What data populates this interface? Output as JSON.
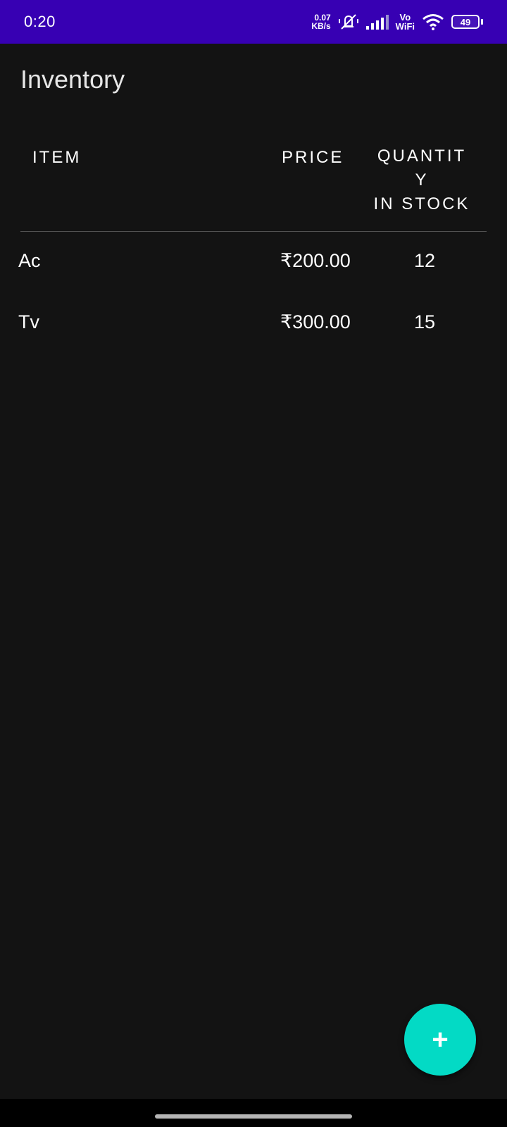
{
  "status_bar": {
    "time": "0:20",
    "net_speed_value": "0.07",
    "net_speed_unit": "KB/s",
    "vowifi_top": "Vo",
    "vowifi_bottom": "WiFi",
    "battery": "49",
    "color": "#3700b3"
  },
  "app": {
    "title": "Inventory"
  },
  "table": {
    "headers": {
      "item": "ITEM",
      "price": "PRICE",
      "quantity_line1": "QUANTIT",
      "quantity_line2": "Y",
      "quantity_line3": "IN STOCK"
    },
    "rows": [
      {
        "name": "Ac",
        "price": "₹200.00",
        "quantity": "12"
      },
      {
        "name": "Tv",
        "price": "₹300.00",
        "quantity": "15"
      }
    ]
  },
  "fab": {
    "icon": "plus-icon",
    "symbol": "+",
    "color": "#03dac5"
  }
}
